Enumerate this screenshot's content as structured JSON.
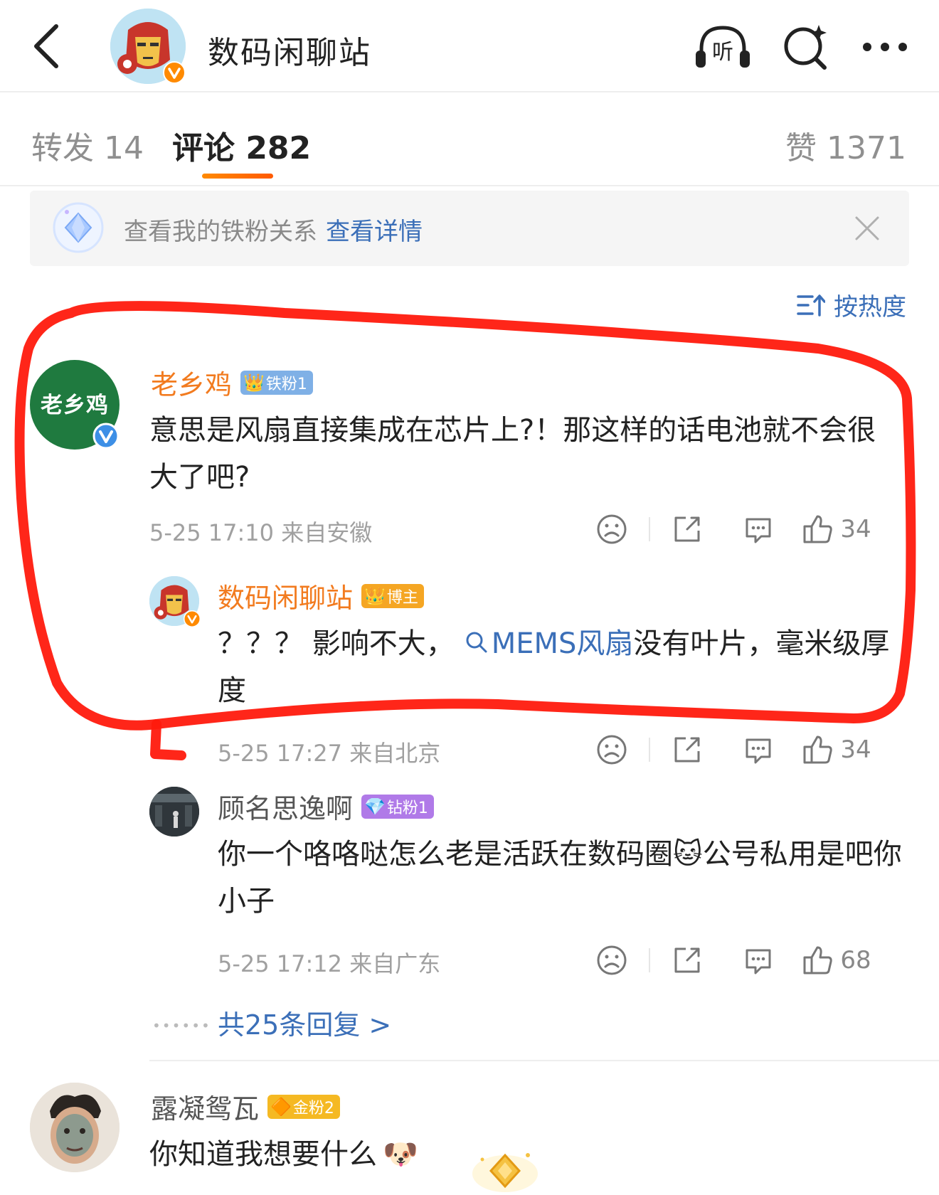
{
  "header": {
    "title": "数码闲聊站",
    "listen_label": "听"
  },
  "tabs": {
    "repost": "转发 14",
    "comment": "评论 282",
    "like": "赞 1371"
  },
  "banner": {
    "text": "查看我的铁粉关系",
    "link": "查看详情"
  },
  "sort": {
    "label": "按热度"
  },
  "comments": [
    {
      "user": "老乡鸡",
      "avatar_text": "老乡鸡",
      "badge": "铁粉1",
      "text": "意思是风扇直接集成在芯片上?！那这样的话电池就不会很大了吧?",
      "time": "5-25 17:10 来自安徽",
      "likes": "34"
    },
    {
      "user": "数码闲聊站",
      "badge": "博主",
      "text_before": "？？？ 影响不大，",
      "topic": "MEMS风扇",
      "text_after": "没有叶片，毫米级厚度",
      "time": "5-25 17:27 来自北京",
      "likes": "34"
    },
    {
      "user": "顾名思逸啊",
      "badge": "钻粉1",
      "text_before": "你一个咯咯哒怎么老是活跃在数码圈",
      "text_after": "公号私用是吧你小子",
      "time": "5-25 17:12 来自广东",
      "likes": "68"
    },
    {
      "user": "露凝鸳瓦",
      "badge": "金粉2",
      "text": "你知道我想要什么"
    }
  ],
  "more_replies": "共25条回复 >",
  "colors": {
    "accent_blue": "#3b6fb8",
    "username_orange": "#f27b1f",
    "tab_underline": "#ff7a00",
    "annotation_red": "#ff1a0d",
    "laoxiangji_green": "#1f7a3f"
  }
}
